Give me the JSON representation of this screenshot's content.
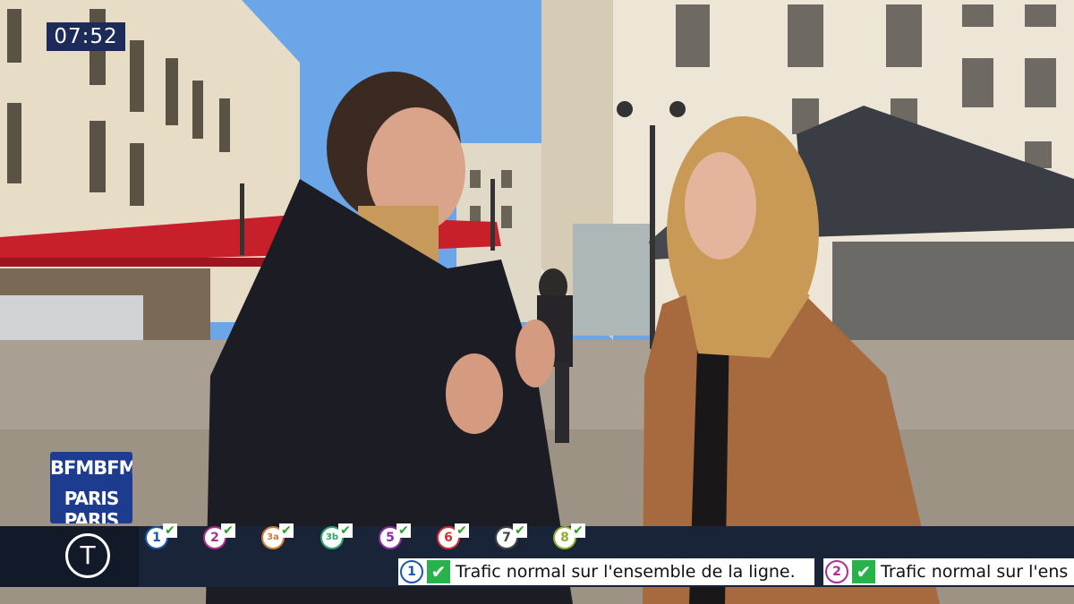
{
  "clock": "07:52",
  "logo": {
    "line1": "BFMBFM",
    "line2": "PARIS PARIS"
  },
  "transport_icon": "T",
  "metro_lines": [
    {
      "label": "1",
      "color": "#1a56b0",
      "status": "check-icon"
    },
    {
      "label": "2",
      "color": "#b02d8f",
      "status": "check-icon"
    },
    {
      "label": "3a",
      "color": "#d27a2f",
      "status": "check-icon"
    },
    {
      "label": "3b",
      "color": "#2fa36b",
      "status": "check-icon"
    },
    {
      "label": "5",
      "color": "#8a2fa3",
      "status": "check-icon"
    },
    {
      "label": "6",
      "color": "#d03030",
      "status": "check-icon"
    },
    {
      "label": "7",
      "color": "#444444",
      "status": "check-icon"
    },
    {
      "label": "8",
      "color": "#8fae2f",
      "status": "check-icon"
    }
  ],
  "ticker": [
    {
      "line": "1",
      "color": "#1a56b0",
      "text": "Trafic normal sur l'ensemble de la ligne."
    },
    {
      "line": "2",
      "color": "#b02d8f",
      "text": "Trafic normal sur l'ens"
    }
  ]
}
